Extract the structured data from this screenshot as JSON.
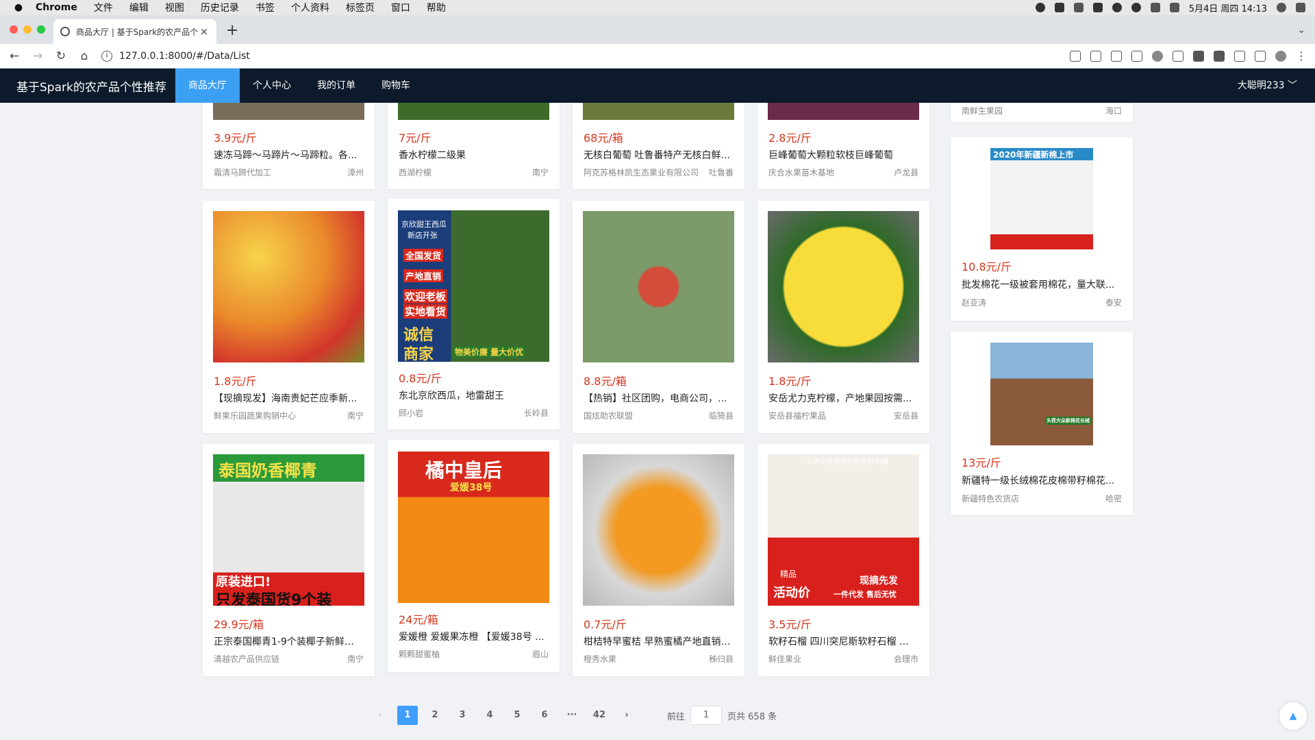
{
  "menubar": {
    "apple": "",
    "items": [
      "Chrome",
      "文件",
      "编辑",
      "视图",
      "历史记录",
      "书签",
      "个人资料",
      "标签页",
      "窗口",
      "帮助"
    ],
    "datetime": "5月4日 周四 14:13"
  },
  "browser": {
    "tab_title": "商品大厅 | 基于Spark的农产品个...",
    "url": "127.0.0.1:8000/#/Data/List"
  },
  "nav": {
    "brand": "基于Spark的农产品个性推荐",
    "items": [
      "商品大厅",
      "个人中心",
      "我的订单",
      "购物车"
    ],
    "user": "大聪明233 ﹀"
  },
  "products_top": [
    {
      "price": "3.9元/斤",
      "name": "速冻马蹄～马蹄片～马蹄粒。各...",
      "shop": "霜清马蹄代加工",
      "loc": "漳州"
    },
    {
      "price": "7元/斤",
      "name": "香水柠檬二级果",
      "shop": "西湖柠檬",
      "loc": "南宁"
    },
    {
      "price": "68元/箱",
      "name": "无核白葡萄 吐鲁番特产无核白鲜...",
      "shop": "阿克苏格林凯生态果业有限公司",
      "loc": "吐鲁番"
    },
    {
      "price": "2.8元/斤",
      "name": "巨峰葡萄大颗粒软枝巨峰葡萄",
      "shop": "庆合水果苗木基地",
      "loc": "卢龙县"
    }
  ],
  "products_mid": [
    {
      "price": "1.8元/斤",
      "name": "【现摘现发】海南贵妃芒应季新...",
      "shop": "鲜果乐园蔬果购销中心",
      "loc": "南宁"
    },
    {
      "price": "0.8元/斤",
      "name": "东北京欣西瓜，地雷甜王",
      "shop": "顾小岩",
      "loc": "长岭县"
    },
    {
      "price": "8.8元/箱",
      "name": "【热销】社区团购，电商公司，...",
      "shop": "国炫助农联盟",
      "loc": "临猗县"
    },
    {
      "price": "1.8元/斤",
      "name": "安岳尤力克柠檬，产地果园按需...",
      "shop": "安岳县福柠果品",
      "loc": "安岳县"
    }
  ],
  "products_bot": [
    {
      "price": "29.9元/箱",
      "name": "正宗泰国椰青1-9个装椰子新鲜水...",
      "shop": "清越农产品供应链",
      "loc": "南宁"
    },
    {
      "price": "24元/箱",
      "name": "爱媛橙 爱媛果冻橙 【爱媛38号 ...",
      "shop": "颗颗甜蜜柚",
      "loc": "眉山"
    },
    {
      "price": "0.7元/斤",
      "name": "柑桔特早蜜桔 早熟蜜橘产地直销 ...",
      "shop": "橙秀水果",
      "loc": "秭归县"
    },
    {
      "price": "3.5元/斤",
      "name": "软籽石榴 四川突尼斯软籽石榴 一...",
      "shop": "鲜佳果业",
      "loc": "会理市"
    }
  ],
  "side": {
    "top_shop": "南鲜生果园",
    "top_loc": "海口",
    "items": [
      {
        "price": "10.8元/斤",
        "name": "批发棉花一级被套用棉花，量大联...",
        "shop": "赵亚涛",
        "loc": "泰安",
        "banner": "2020年新疆新棉上市"
      },
      {
        "price": "13元/斤",
        "name": "新疆特一级长绒棉花皮棉带籽棉花...",
        "shop": "新疆特色农货店",
        "loc": "哈密",
        "banner": "头茬大朵新棉花长绒"
      }
    ]
  },
  "image_text": {
    "melon_lines": [
      "京欣甜王西瓜",
      "新店开张",
      "全国发货",
      "产地直销",
      "欢迎老板",
      "实地看货",
      "诚信",
      "商家",
      "物美价廉 量大价优"
    ],
    "coconut_top": "泰国奶香椰青",
    "coconut_mid": "原装进口!",
    "coconut_bottom": "只发泰国货9个装",
    "aiyuan_top": "橘中皇后",
    "aiyuan_sub": "爱媛38号",
    "pomegranate_top": "大凉山会理突尼斯软籽石榴",
    "pomegranate_l1": "精品",
    "pomegranate_l2": "活动价",
    "pomegranate_r1": "现摘先发",
    "pomegranate_r2": "一件代发 售后无忧"
  },
  "pagination": {
    "prev": "‹",
    "pages": [
      "1",
      "2",
      "3",
      "4",
      "5",
      "6",
      "···",
      "42"
    ],
    "next": "›",
    "goto_label": "前往",
    "goto_value": "1",
    "total": "页共 658 条"
  },
  "backtop": "▲",
  "colors": {
    "nav_bg": "#0c1a2b",
    "accent": "#3ba0f4",
    "price": "#d4351c"
  }
}
